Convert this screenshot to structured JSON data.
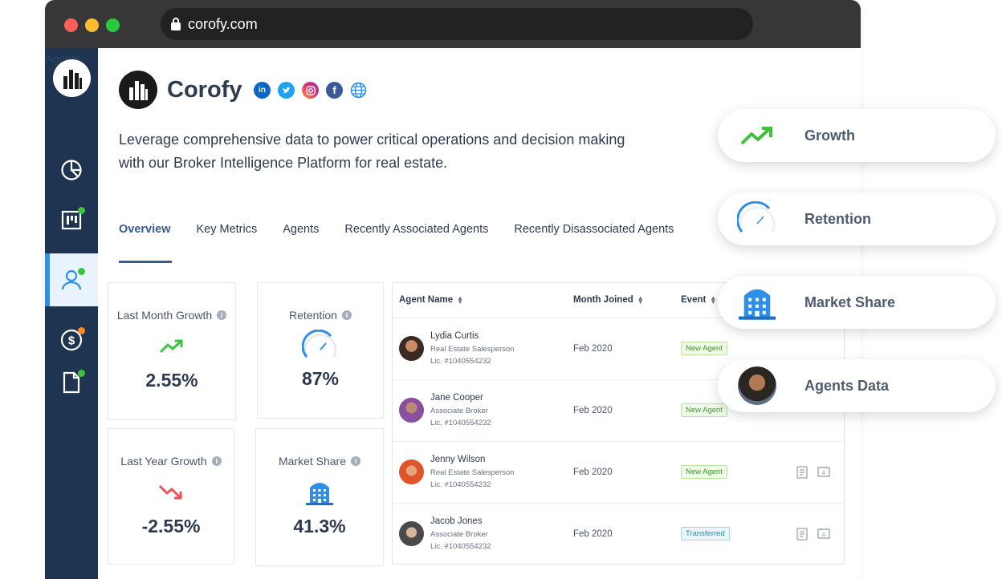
{
  "browser": {
    "url": "corofy.com"
  },
  "sidebar": {
    "ghost_label": "Agents",
    "items": [
      {
        "icon": "pie-chart-icon"
      },
      {
        "icon": "kanban-board-icon",
        "badge": "#3ec13e"
      },
      {
        "icon": "agent-user-icon",
        "badge": "#3ec13e",
        "active": true
      },
      {
        "icon": "dollar-coin-icon",
        "badge": "#ff8a1f"
      },
      {
        "icon": "document-icon",
        "badge": "#3ec13e"
      }
    ]
  },
  "brand": {
    "name": "Corofy",
    "socials": [
      "linkedin-icon",
      "twitter-icon",
      "instagram-icon",
      "facebook-icon",
      "globe-icon"
    ],
    "tagline": "Leverage comprehensive data to power critical operations and decision making with our Broker Intelligence Platform for real estate."
  },
  "tabs": [
    {
      "label": "Overview",
      "active": true
    },
    {
      "label": "Key Metrics"
    },
    {
      "label": "Agents"
    },
    {
      "label": "Recently Associated Agents"
    },
    {
      "label": "Recently Disassociated Agents"
    }
  ],
  "metrics": {
    "last_month_growth": {
      "title": "Last Month Growth",
      "value": "2.55%",
      "trend_color": "#3ec13e"
    },
    "retention": {
      "title": "Retention",
      "value": "87%",
      "gauge_percent": 87
    },
    "last_year_growth": {
      "title": "Last Year Growth",
      "value": "-2.55%",
      "trend_color": "#f0504f"
    },
    "market_share": {
      "title": "Market Share",
      "value": "41.3%"
    }
  },
  "table": {
    "headers": {
      "name": "Agent Name",
      "month": "Month Joined",
      "event": "Event"
    },
    "rows": [
      {
        "name": "Lydia Curtis",
        "role": "Real Estate Salesperson",
        "license": "Lic. #1040554232",
        "month": "Feb 2020",
        "event": "New Agent"
      },
      {
        "name": "Jane Cooper",
        "role": "Associate Broker",
        "license": "Lic. #1040554232",
        "month": "Feb 2020",
        "event": "New Agent"
      },
      {
        "name": "Jenny Wilson",
        "role": "Real Estate Salesperson",
        "license": "Lic. #1040554232",
        "month": "Feb 2020",
        "event": "New Agent"
      },
      {
        "name": "Jacob Jones",
        "role": "Associate Broker",
        "license": "Lic. #1040554232",
        "month": "Feb 2020",
        "event": "Transferred"
      }
    ]
  },
  "pills": [
    {
      "label": "Growth",
      "icon": "growth-trend-icon"
    },
    {
      "label": "Retention",
      "icon": "retention-gauge-icon"
    },
    {
      "label": "Market Share",
      "icon": "building-icon"
    },
    {
      "label": "Agents Data",
      "icon": "agent-photo-icon"
    }
  ],
  "colors": {
    "sidebar": "#1f3450",
    "accent": "#3a5a94",
    "active_nav": "#2f8fe8"
  }
}
